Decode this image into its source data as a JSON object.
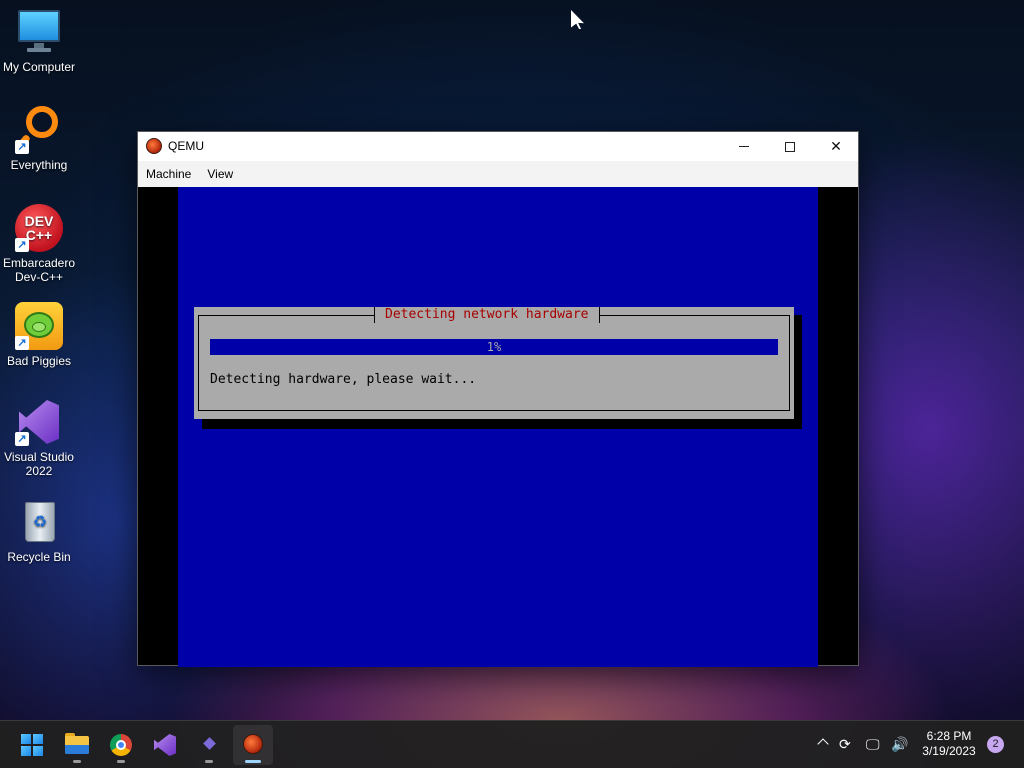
{
  "desktop": {
    "icons": [
      {
        "label": "My Computer",
        "icon": "computer-icon"
      },
      {
        "label": "Everything",
        "icon": "magnifier-icon"
      },
      {
        "label": "Embarcadero Dev-C++",
        "icon": "devcpp-icon",
        "logo_text": "DEV C++"
      },
      {
        "label": "Bad Piggies",
        "icon": "bad-piggies-icon"
      },
      {
        "label": "Visual Studio 2022",
        "icon": "visual-studio-icon"
      },
      {
        "label": "Recycle Bin",
        "icon": "recycle-bin-icon"
      }
    ]
  },
  "window": {
    "title": "QEMU",
    "menu": [
      "Machine",
      "View"
    ],
    "controls": {
      "minimize": "minimize",
      "maximize": "maximize",
      "close": "close"
    }
  },
  "installer": {
    "dialog_title": "Detecting network hardware",
    "progress_percent": 1,
    "progress_label": "1%",
    "message": "Detecting hardware, please wait...",
    "colors": {
      "screen": "#0000a8",
      "dialog": "#aaaaaa",
      "title": "#a80000"
    }
  },
  "taskbar": {
    "apps": [
      "start-icon",
      "file-explorer-icon",
      "chrome-icon",
      "visual-studio-icon",
      "dev-home-icon",
      "qemu-icon"
    ],
    "active_app": "qemu-icon",
    "clock_time": "6:28 PM",
    "clock_date": "3/19/2023",
    "notification_count": "2"
  }
}
